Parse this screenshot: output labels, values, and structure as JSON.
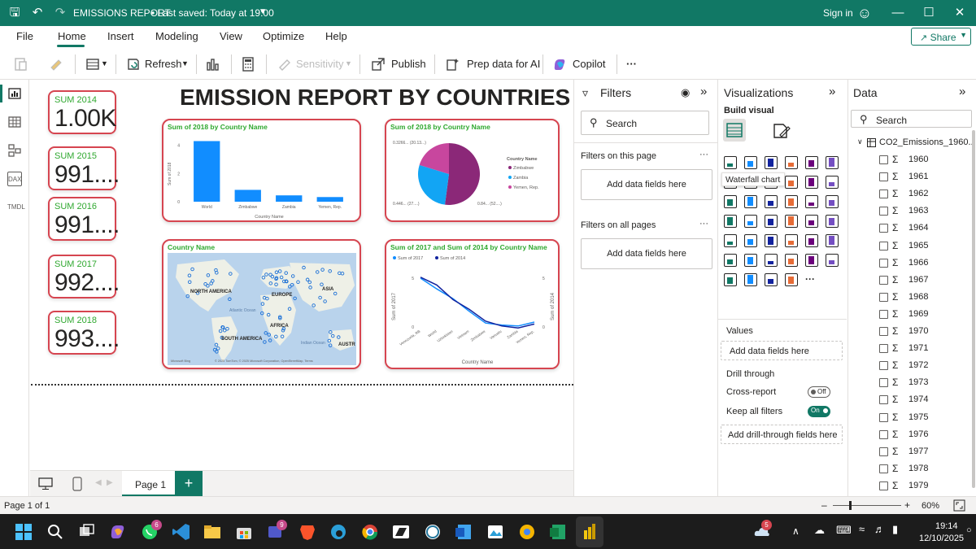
{
  "titlebar": {
    "app_title": "EMISSIONS REPORT",
    "saved_status": "• Last saved: Today at 19:00",
    "sign_in": "Sign in"
  },
  "menu": {
    "items": [
      "File",
      "Home",
      "Insert",
      "Modeling",
      "View",
      "Optimize",
      "Help"
    ],
    "share": "Share"
  },
  "toolbar": {
    "refresh": "Refresh",
    "sensitivity": "Sensitivity",
    "publish": "Publish",
    "prep_ai": "Prep data for AI",
    "copilot": "Copilot",
    "more": "···"
  },
  "rail": {
    "dax": "DAX",
    "tmdl": "TMDL"
  },
  "report": {
    "title": "EMISSION REPORT BY COUNTRIES",
    "cards": [
      {
        "label": "SUM 2014",
        "value": "1.00K"
      },
      {
        "label": "SUM 2015",
        "value": "991...."
      },
      {
        "label": "SUM 2016",
        "value": "991...."
      },
      {
        "label": "SUM 2017",
        "value": "992...."
      },
      {
        "label": "SUM 2018",
        "value": "993...."
      }
    ],
    "bar_title": "Sum of 2018 by Country Name",
    "bar_ylabel": "Sum of 2018",
    "bar_xlabel": "Country Name",
    "pie_title": "Sum of 2018 by Country Name",
    "pie_legend_title": "Country Name",
    "pie_labels": {
      "top": "0.3266... (20.13...)",
      "bottom_left": "0.446... (27....)",
      "bottom_right": "0.84... (52....)"
    },
    "map_title": "Country Name",
    "map_labels": {
      "na": "NORTH AMERICA",
      "eu": "EUROPE",
      "asia": "ASIA",
      "sa": "SOUTH AMERICA",
      "af": "AFRICA",
      "au": "AUSTR",
      "atl": "Atlantic Ocean",
      "ind": "Indian Ocean",
      "credit": "© 2025 TomTom, © 2025 Microsoft Corporation, OpenStreetMap, Terms",
      "ms": "Microsoft Bing"
    },
    "line_title": "Sum of 2017 and Sum of 2014 by Country Name",
    "line_ylabel_left": "Sum of 2017",
    "line_ylabel_right": "Sum of 2014",
    "line_xlabel": "Country Name"
  },
  "chart_data": [
    {
      "type": "bar",
      "title": "Sum of 2018 by Country Name",
      "categories": [
        "World",
        "Zimbabwe",
        "Zambia",
        "Yemen, Rep."
      ],
      "values": [
        4.3,
        0.84,
        0.45,
        0.33
      ],
      "xlabel": "Country Name",
      "ylabel": "Sum of 2018",
      "ylim": [
        0,
        4.5
      ],
      "yticks": [
        0,
        2,
        4
      ],
      "color": "#118dff"
    },
    {
      "type": "pie",
      "title": "Sum of 2018 by Country Name",
      "categories": [
        "Zimbabwe",
        "Zambia",
        "Yemen, Rep."
      ],
      "values": [
        0.84,
        0.446,
        0.3266
      ],
      "percent": [
        52,
        27,
        20.13
      ],
      "colors": [
        "#8b2878",
        "#12a5f4",
        "#c8469e"
      ],
      "legend": "right"
    },
    {
      "type": "line",
      "title": "Sum of 2017 and Sum of 2014 by Country Name",
      "categories": [
        "Venezuela, RB",
        "World",
        "Uzbekistan",
        "Vietnam",
        "Zimbabwe",
        "Vanuatu",
        "Zambia",
        "Yemen, Rep."
      ],
      "series": [
        {
          "name": "Sum of 2017",
          "values": [
            5.0,
            3.9,
            2.9,
            1.6,
            0.4,
            0.2,
            0.1,
            0.5
          ],
          "color": "#118dff"
        },
        {
          "name": "Sum of 2014",
          "values": [
            5.1,
            4.3,
            2.8,
            1.8,
            0.6,
            0.1,
            -0.1,
            0.3
          ],
          "color": "#12239e"
        }
      ],
      "xlabel": "Country Name",
      "ylim": [
        0,
        5
      ],
      "yticks": [
        0,
        5
      ]
    }
  ],
  "filters": {
    "title": "Filters",
    "search": "Search",
    "on_page": "Filters on this page",
    "on_all": "Filters on all pages",
    "add": "Add data fields here",
    "more": "···"
  },
  "viz": {
    "title": "Visualizations",
    "build": "Build visual",
    "tooltip": "Waterfall chart",
    "values": "Values",
    "add_values": "Add data fields here",
    "drill": "Drill through",
    "cross": "Cross-report",
    "cross_state": "Off",
    "keep": "Keep all filters",
    "keep_state": "On",
    "add_drill": "Add drill-through fields here"
  },
  "data": {
    "title": "Data",
    "search": "Search",
    "table": "CO2_Emissions_1960...",
    "fields": [
      "1960",
      "1961",
      "1962",
      "1963",
      "1964",
      "1965",
      "1966",
      "1967",
      "1968",
      "1969",
      "1970",
      "1971",
      "1972",
      "1973",
      "1974",
      "1975",
      "1976",
      "1977",
      "1978",
      "1979"
    ]
  },
  "pages": {
    "tab": "Page 1",
    "add": "+"
  },
  "status": {
    "page": "Page 1 of 1",
    "zoom": "60%"
  },
  "taskbar": {
    "time": "19:14",
    "date": "12/10/2025",
    "badge1": "6",
    "badge2": "9",
    "badge3": "5"
  }
}
